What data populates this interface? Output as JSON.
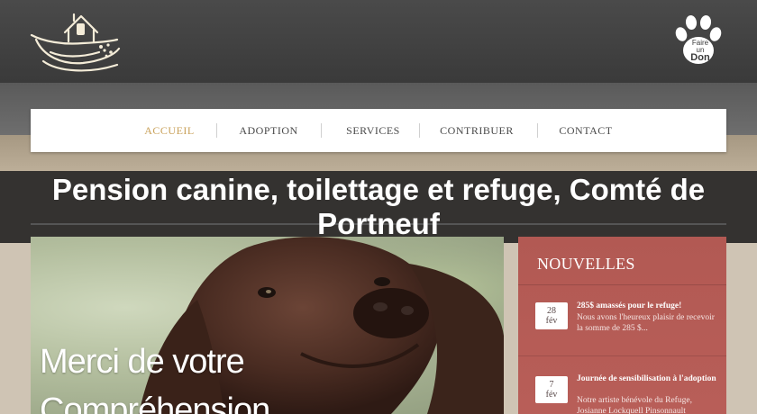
{
  "header": {
    "logo_icon": "ark-house-logo",
    "donate": {
      "line1": "Faire",
      "line2": "un",
      "line3": "Don",
      "icon": "paw-icon"
    }
  },
  "nav": {
    "items": [
      {
        "label": "ACCUEIL",
        "active": true
      },
      {
        "label": "ADOPTION",
        "active": false
      },
      {
        "label": "SERVICES",
        "active": false
      },
      {
        "label": "CONTRIBUER",
        "active": false
      },
      {
        "label": "CONTACT",
        "active": false
      }
    ]
  },
  "page_title": "Pension canine, toilettage et refuge, Comté de Portneuf",
  "hero": {
    "line1": "Merci de votre",
    "line2": "Compréhension"
  },
  "news": {
    "title": "NOUVELLES",
    "items": [
      {
        "day": "28",
        "month": "fév",
        "headline": "285$ amassés pour le refuge!",
        "body": "Nous avons l'heureux plaisir de recevoir la somme de 285 $..."
      },
      {
        "day": "7",
        "month": "fév",
        "headline": "Journée de sensibilisation à l'adoption",
        "body": "Notre artiste bénévole du Refuge, Josianne Lockquell Pinsonnault"
      }
    ]
  },
  "colors": {
    "header_bg": "#3f3f3f",
    "nav_active": "#c9a15a",
    "news_bg": "#b25953"
  }
}
